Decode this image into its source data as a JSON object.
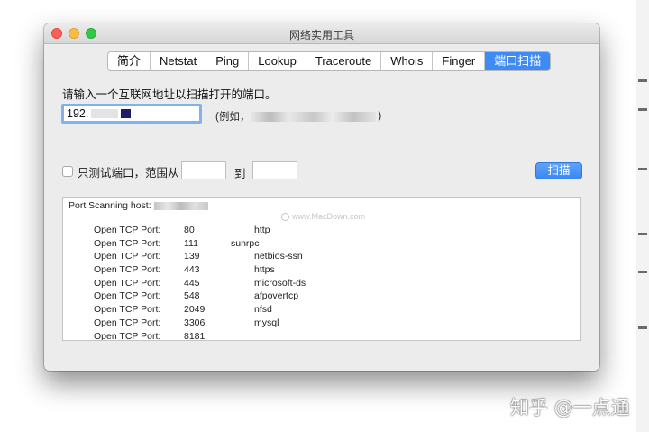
{
  "window": {
    "title": "网络实用工具"
  },
  "tabs": [
    {
      "label": "简介",
      "active": false
    },
    {
      "label": "Netstat",
      "active": false
    },
    {
      "label": "Ping",
      "active": false
    },
    {
      "label": "Lookup",
      "active": false
    },
    {
      "label": "Traceroute",
      "active": false
    },
    {
      "label": "Whois",
      "active": false
    },
    {
      "label": "Finger",
      "active": false
    },
    {
      "label": "端口扫描",
      "active": true
    }
  ],
  "form": {
    "prompt": "请输入一个互联网地址以扫描打开的端口。",
    "address_value": "192.",
    "example_prefix": "(例如，",
    "example_suffix": ")",
    "only_test_label": "只测试端口，范围从",
    "range_from": "",
    "range_to_label": "到",
    "range_to": "",
    "scan_button": "扫描"
  },
  "output": {
    "header": "Port Scanning host:",
    "watermark": "www.MacDown.com",
    "rows": [
      {
        "label": "Open TCP Port:",
        "port": "80",
        "service": "http"
      },
      {
        "label": "Open TCP Port:",
        "port": "111",
        "service": "sunrpc"
      },
      {
        "label": "Open TCP Port:",
        "port": "139",
        "service": "netbios-ssn"
      },
      {
        "label": "Open TCP Port:",
        "port": "443",
        "service": "https"
      },
      {
        "label": "Open TCP Port:",
        "port": "445",
        "service": "microsoft-ds"
      },
      {
        "label": "Open TCP Port:",
        "port": "548",
        "service": "afpovertcp"
      },
      {
        "label": "Open TCP Port:",
        "port": "2049",
        "service": "nfsd"
      },
      {
        "label": "Open TCP Port:",
        "port": "3306",
        "service": "mysql"
      },
      {
        "label": "Open TCP Port:",
        "port": "8181",
        "service": ""
      }
    ]
  },
  "overlay": {
    "watermark": "知乎 @一点通"
  },
  "colors": {
    "accent": "#3f8bf6",
    "close": "#fc605b",
    "minimize": "#fdbc40",
    "maximize": "#34c84a"
  }
}
